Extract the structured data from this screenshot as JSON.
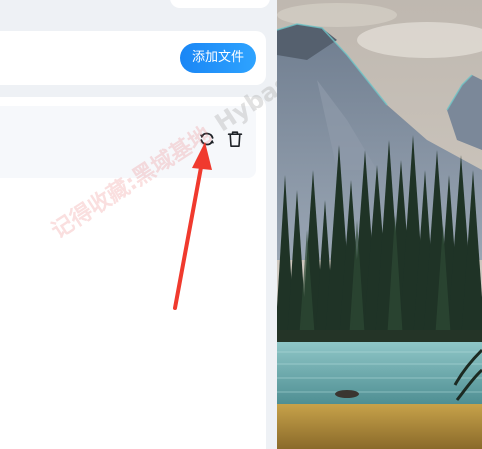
{
  "toolbar": {
    "add_file_label": "添加文件"
  },
  "file_item": {
    "actions": [
      {
        "icon": "refresh-icon"
      },
      {
        "icon": "trash-icon"
      }
    ]
  },
  "watermark": {
    "red_text": "记得收藏:黑域基地",
    "gray_text": "Hybas"
  },
  "colors": {
    "accent": "#1a86f5",
    "arrow": "#f03a2e",
    "panel_bg": "#eef1f5",
    "card_bg": "#ffffff",
    "item_bg": "#f6f8fb"
  }
}
